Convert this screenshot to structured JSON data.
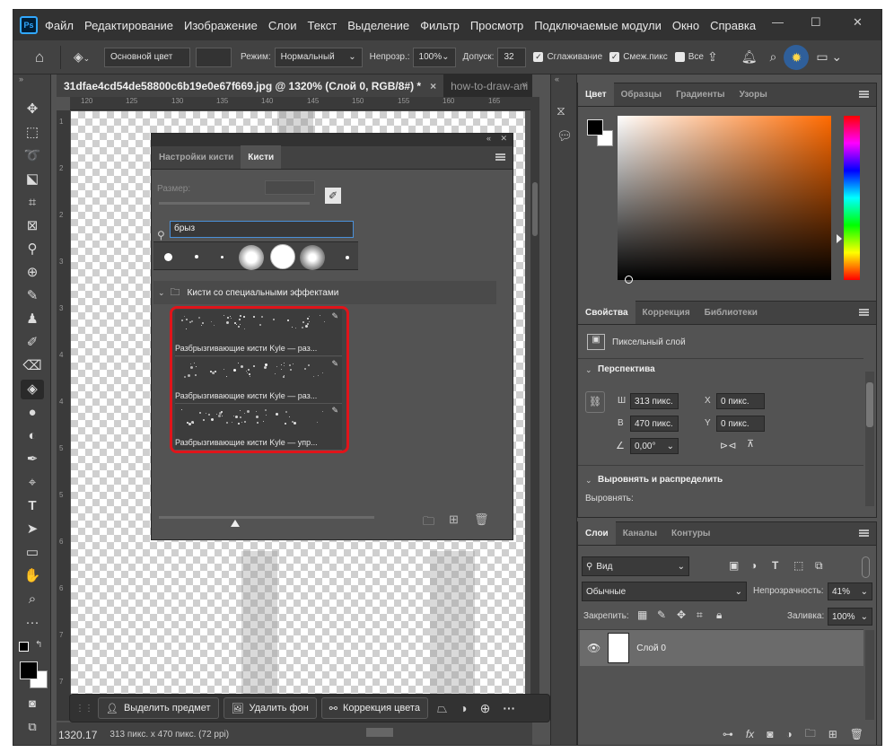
{
  "app": {
    "logo": "Ps"
  },
  "menu": [
    "Файл",
    "Редактирование",
    "Изображение",
    "Слои",
    "Текст",
    "Выделение",
    "Фильтр",
    "Просмотр",
    "Подключаемые модули",
    "Окно",
    "Справка"
  ],
  "window_controls": {
    "minimize": "—",
    "maximize": "☐",
    "close": "✕"
  },
  "options": {
    "home_icon": "home-icon",
    "fill_source": "Основной цвет",
    "mode_label": "Режим:",
    "mode_value": "Нормальный",
    "opacity_label": "Непрозр.:",
    "opacity_value": "100%",
    "tolerance_label": "Допуск:",
    "tolerance_value": "32",
    "antialias_label": "Сглаживание",
    "antialias_checked": true,
    "contiguous_label": "Смеж.пикс",
    "contiguous_checked": true,
    "all_layers_label": "Все",
    "all_layers_checked": false
  },
  "tabs": [
    {
      "label": "31dfae4cd54de58800c6b19e0e67f669.jpg @ 1320% (Слой 0, RGB/8#) *",
      "close": "×",
      "active": true
    },
    {
      "label": "how-to-draw-ani",
      "active": false
    }
  ],
  "ruler": {
    "h": [
      "120",
      "125",
      "130",
      "135",
      "140",
      "145",
      "150",
      "155",
      "160",
      "165"
    ],
    "v": [
      "1",
      "2",
      "2",
      "3",
      "3",
      "4",
      "4",
      "5",
      "5",
      "6",
      "6",
      "7",
      "7"
    ]
  },
  "brush_panel": {
    "tabs": [
      "Настройки кисти",
      "Кисти"
    ],
    "size_label": "Размер:",
    "search_value": "брыз",
    "folder_label": "Кисти со специальными эффектами",
    "brushes": [
      "Разбрызгивающие кисти Kyle — раз...",
      "Разбрызгивающие кисти Kyle — раз...",
      "Разбрызгивающие кисти Kyle — упр..."
    ]
  },
  "context_bar": {
    "select_subject": "Выделить предмет",
    "remove_bg": "Удалить фон",
    "color_correct": "Коррекция цвета",
    "more": "···"
  },
  "status": {
    "zoom": "1320.17",
    "size": "313 пикс. x 470 пикс. (72 ppi)"
  },
  "color_panel": {
    "tabs": [
      "Цвет",
      "Образцы",
      "Градиенты",
      "Узоры"
    ],
    "hue_color": "#ff6a00"
  },
  "properties": {
    "tabs": [
      "Свойства",
      "Коррекция",
      "Библиотеки"
    ],
    "layer_type": "Пиксельный слой",
    "section_transform": "Перспектива",
    "w_label": "Ш",
    "w_value": "313 пикс.",
    "h_label": "В",
    "h_value": "470 пикс.",
    "x_label": "X",
    "x_value": "0 пикс.",
    "y_label": "Y",
    "y_value": "0 пикс.",
    "angle_value": "0,00°",
    "section_align": "Выровнять и распределить",
    "align_label": "Выровнять:"
  },
  "layers": {
    "tabs": [
      "Слои",
      "Каналы",
      "Контуры"
    ],
    "filter_value": "Вид",
    "blend_value": "Обычные",
    "opacity_label": "Непрозрачность:",
    "opacity_value": "41%",
    "lock_label": "Закрепить:",
    "fill_label": "Заливка:",
    "fill_value": "100%",
    "items": [
      {
        "name": "Слой 0",
        "visible": true
      }
    ]
  }
}
